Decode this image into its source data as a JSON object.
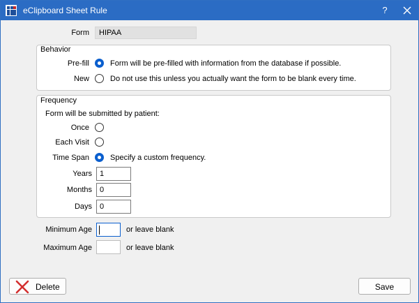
{
  "window": {
    "title": "eClipboard Sheet Rule",
    "help_label": "?"
  },
  "form": {
    "label": "Form",
    "value": "HIPAA"
  },
  "behavior": {
    "title": "Behavior",
    "options": [
      {
        "label": "Pre-fill",
        "description": "Form will be pre-filled with information from the database if possible.",
        "selected": true
      },
      {
        "label": "New",
        "description": "Do not use this unless you actually want the form to be blank every time.",
        "selected": false
      }
    ]
  },
  "frequency": {
    "title": "Frequency",
    "intro": "Form will be submitted by patient:",
    "options": [
      {
        "label": "Once",
        "selected": false
      },
      {
        "label": "Each Visit",
        "selected": false
      },
      {
        "label": "Time Span",
        "description": "Specify a custom frequency.",
        "selected": true
      }
    ],
    "years": {
      "label": "Years",
      "value": "1"
    },
    "months": {
      "label": "Months",
      "value": "0"
    },
    "days": {
      "label": "Days",
      "value": "0"
    }
  },
  "age": {
    "min_label": "Minimum Age",
    "min_value": "",
    "max_label": "Maximum Age",
    "max_value": "",
    "hint": "or leave blank"
  },
  "buttons": {
    "delete_label": "Delete",
    "save_label": "Save"
  },
  "colors": {
    "titlebar": "#2b6cc4",
    "accent": "#0b5fce",
    "delete_icon": "#d32f2f"
  },
  "icons": {
    "app": "grid-app-icon",
    "close": "close-icon",
    "delete": "red-x-icon"
  }
}
